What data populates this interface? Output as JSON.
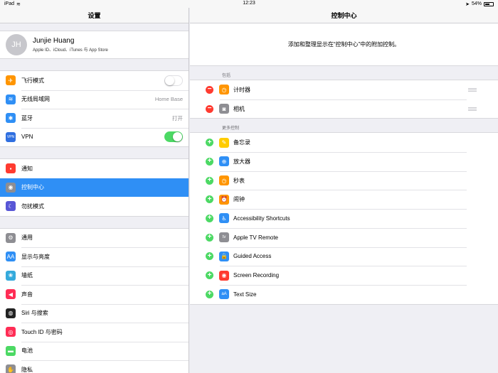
{
  "status": {
    "device": "iPad",
    "time": "12:23",
    "battery": "54%"
  },
  "left": {
    "title": "设置",
    "profile": {
      "initials": "JH",
      "name": "Junjie Huang",
      "subtitle": "Apple ID、iCloud、iTunes 与 App Store"
    },
    "group1": [
      {
        "label": "飞行模式",
        "icon": "airplane-icon",
        "color": "#ff9500",
        "glyph": "✈",
        "toggle": "off"
      },
      {
        "label": "无线局域网",
        "icon": "wifi-icon",
        "color": "#2f8ff5",
        "glyph": "≋",
        "value": "Home Base"
      },
      {
        "label": "蓝牙",
        "icon": "bluetooth-icon",
        "color": "#2f8ff5",
        "glyph": "✱",
        "value": "打开"
      },
      {
        "label": "VPN",
        "icon": "vpn-icon",
        "color": "#2f6fe0",
        "glyph": "VPN",
        "toggle": "on"
      }
    ],
    "group2": [
      {
        "label": "通知",
        "icon": "notification-icon",
        "color": "#ff3b30",
        "glyph": "▪"
      },
      {
        "label": "控制中心",
        "icon": "control-center-icon",
        "color": "#8e8e93",
        "glyph": "◉",
        "selected": true
      },
      {
        "label": "勿扰模式",
        "icon": "moon-icon",
        "color": "#5856d6",
        "glyph": "☾"
      }
    ],
    "group3": [
      {
        "label": "通用",
        "icon": "gear-icon",
        "color": "#8e8e93",
        "glyph": "⚙"
      },
      {
        "label": "显示与亮度",
        "icon": "display-icon",
        "color": "#2f8ff5",
        "glyph": "AA"
      },
      {
        "label": "墙纸",
        "icon": "wallpaper-icon",
        "color": "#34aadc",
        "glyph": "❀"
      },
      {
        "label": "声音",
        "icon": "sound-icon",
        "color": "#ff2d55",
        "glyph": "◀"
      },
      {
        "label": "Siri 与搜索",
        "icon": "siri-icon",
        "color": "#222222",
        "glyph": "◍"
      },
      {
        "label": "Touch ID 与密码",
        "icon": "fingerprint-icon",
        "color": "#ff2d55",
        "glyph": "◎"
      },
      {
        "label": "电池",
        "icon": "battery-icon",
        "color": "#4cd964",
        "glyph": "▬"
      },
      {
        "label": "隐私",
        "icon": "privacy-icon",
        "color": "#8e8e93",
        "glyph": "✋"
      }
    ]
  },
  "right": {
    "title": "控制中心",
    "info": "添加和整理显示在“控制中心”中的附加控制。",
    "included_header": "包括",
    "included": [
      {
        "label": "计时器",
        "icon": "timer-icon",
        "color": "#ff9500",
        "glyph": "◷"
      },
      {
        "label": "相机",
        "icon": "camera-icon",
        "color": "#8e8e93",
        "glyph": "◙"
      }
    ],
    "more_header": "更多控制",
    "more": [
      {
        "label": "备忘录",
        "icon": "notes-icon",
        "color": "#ffcc00",
        "glyph": "✎"
      },
      {
        "label": "放大器",
        "icon": "magnifier-icon",
        "color": "#2f8ff5",
        "glyph": "⊕"
      },
      {
        "label": "秒表",
        "icon": "stopwatch-icon",
        "color": "#ff9500",
        "glyph": "◷"
      },
      {
        "label": "闹钟",
        "icon": "alarm-icon",
        "color": "#ff9500",
        "glyph": "⏰"
      },
      {
        "label": "Accessibility Shortcuts",
        "icon": "accessibility-icon",
        "color": "#2f8ff5",
        "glyph": "♿"
      },
      {
        "label": "Apple TV Remote",
        "icon": "remote-icon",
        "color": "#8e8e93",
        "glyph": "tv"
      },
      {
        "label": "Guided Access",
        "icon": "lock-icon",
        "color": "#2f8ff5",
        "glyph": "🔒"
      },
      {
        "label": "Screen Recording",
        "icon": "record-icon",
        "color": "#ff3b30",
        "glyph": "◉"
      },
      {
        "label": "Text Size",
        "icon": "text-size-icon",
        "color": "#2f8ff5",
        "glyph": "aA"
      }
    ]
  }
}
